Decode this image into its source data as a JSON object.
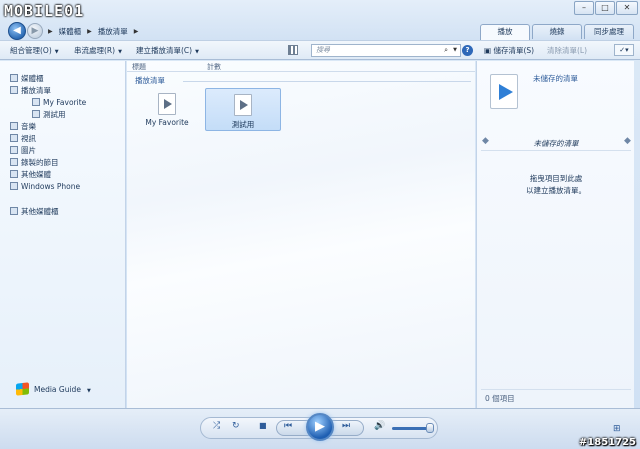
{
  "watermark": {
    "logo": "MOBILE01",
    "id": "#1851725"
  },
  "nav": {
    "crumbs": [
      "媒體櫃",
      "播放清單"
    ]
  },
  "tabs": [
    "播放",
    "燒錄",
    "同步處理"
  ],
  "toolbar": {
    "organize": "組合管理(O)",
    "stream": "串流處理(R)",
    "create_playlist": "建立播放清單(C)",
    "search_placeholder": "搜尋",
    "save_list": "儲存清單(S)",
    "clear_list": "清除清單(L)"
  },
  "leftnav": {
    "library": "媒體櫃",
    "playlists": "播放清單",
    "playlist_items": [
      "My Favorite",
      "測試用"
    ],
    "music": "音樂",
    "videos": "視訊",
    "pictures": "圖片",
    "recorded_tv": "錄製的節目",
    "other_media": "其他媒體",
    "windows_phone": "Windows Phone",
    "other_libraries": "其他媒體櫃",
    "media_guide": "Media Guide"
  },
  "main": {
    "columns": [
      "標題",
      "計數"
    ],
    "group": "播放清單",
    "tiles": [
      {
        "label": "My Favorite",
        "selected": false
      },
      {
        "label": "測試用",
        "selected": true
      }
    ]
  },
  "right": {
    "unsaved_top": "未儲存的清單",
    "unsaved_mid": "未儲存的清單",
    "drag_line1": "拖曳項目到此處",
    "drag_line2": "以建立播放清單。",
    "item_count": "0 個項目"
  },
  "colors": {
    "accent": "#2e68b8",
    "window_bg": "#dce9f7"
  },
  "icons": {
    "back": "back-arrow-icon",
    "play": "play-icon",
    "mute": "speaker-icon"
  }
}
